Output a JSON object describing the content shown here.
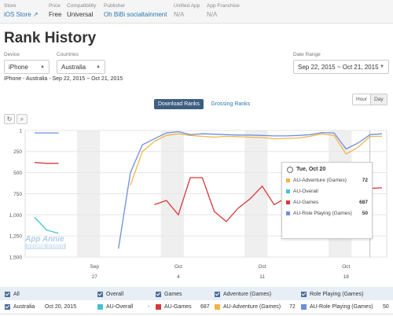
{
  "meta": {
    "store": {
      "label": "Store",
      "value": "iOS Store ↗"
    },
    "price": {
      "label": "Price",
      "value": "Free"
    },
    "compatibility": {
      "label": "Compatibility",
      "value": "Universal"
    },
    "publisher": {
      "label": "Publisher",
      "value": "Oh BiBi socialtainment"
    },
    "unified_app": {
      "label": "Unified App",
      "value": "N/A"
    },
    "app_franchise": {
      "label": "App Franchise",
      "value": "N/A"
    }
  },
  "page_title": "Rank History",
  "filters": {
    "device": {
      "label": "Device",
      "value": "iPhone"
    },
    "countries": {
      "label": "Countries",
      "value": "Australia"
    },
    "date_range": {
      "label": "Date Range",
      "value": "Sep 22, 2015 ~ Oct 21, 2015"
    }
  },
  "subtitle": "IPhone - Australia - Sep 22, 2015 ~ Oct 21, 2015",
  "rank_toggle": {
    "download": "Download Ranks",
    "grossing": "Grossing Ranks"
  },
  "granularity": {
    "hour": "Hour",
    "day": "Day"
  },
  "watermark": {
    "line1": "App Annie",
    "line2": "STORE STATS"
  },
  "chart_data": {
    "type": "line",
    "x_dates": [
      "Sep 22",
      "Sep 23",
      "Sep 24",
      "Sep 25",
      "Sep 26",
      "Sep 27",
      "Sep 28",
      "Sep 29",
      "Sep 30",
      "Oct 1",
      "Oct 2",
      "Oct 3",
      "Oct 4",
      "Oct 5",
      "Oct 6",
      "Oct 7",
      "Oct 8",
      "Oct 9",
      "Oct 10",
      "Oct 11",
      "Oct 12",
      "Oct 13",
      "Oct 14",
      "Oct 15",
      "Oct 16",
      "Oct 17",
      "Oct 18",
      "Oct 19",
      "Oct 20",
      "Oct 21"
    ],
    "x_tick_labels": [
      {
        "month": "Sep",
        "day": "27",
        "index": 5
      },
      {
        "month": "Oct",
        "day": "4",
        "index": 12
      },
      {
        "month": "Oct",
        "day": "11",
        "index": 19
      },
      {
        "month": "Oct",
        "day": "18",
        "index": 26
      }
    ],
    "y_ticks": [
      "1",
      "250",
      "500",
      "750",
      "1,000",
      "1,250",
      "1,500"
    ],
    "ylim": [
      1,
      1500
    ],
    "y_reversed": true,
    "series": [
      {
        "name": "AU-Role Playing (Games)",
        "color": "#6d8fdc",
        "values": [
          30,
          30,
          30,
          null,
          null,
          null,
          null,
          1400,
          500,
          170,
          100,
          30,
          15,
          50,
          40,
          45,
          50,
          55,
          55,
          60,
          65,
          65,
          60,
          50,
          25,
          30,
          220,
          150,
          50,
          40
        ]
      },
      {
        "name": "AU-Adventure (Games)",
        "color": "#f3b545",
        "values": [
          null,
          null,
          null,
          null,
          null,
          null,
          null,
          null,
          650,
          250,
          130,
          60,
          40,
          60,
          70,
          80,
          70,
          75,
          80,
          85,
          100,
          95,
          90,
          70,
          40,
          60,
          280,
          200,
          72,
          70
        ]
      },
      {
        "name": "AU-Games",
        "color": "#d93838",
        "values": [
          380,
          390,
          390,
          null,
          null,
          null,
          null,
          null,
          null,
          null,
          880,
          830,
          1000,
          560,
          560,
          960,
          1080,
          920,
          810,
          660,
          880,
          800,
          920,
          960,
          880,
          1000,
          null,
          null,
          687,
          680
        ]
      },
      {
        "name": "AU-Overall",
        "color": "#47c1cf",
        "values": [
          1030,
          1180,
          1220,
          null,
          null,
          null,
          null,
          null,
          null,
          null,
          null,
          null,
          null,
          null,
          null,
          null,
          null,
          null,
          null,
          null,
          null,
          null,
          null,
          null,
          null,
          null,
          null,
          null,
          null,
          null
        ]
      }
    ]
  },
  "tooltip": {
    "date": "Tue, Oct 20",
    "rows": [
      {
        "name": "AU-Adventure (Games)",
        "value": "72",
        "color": "#f3b545"
      },
      {
        "name": "AU-Overall",
        "value": "",
        "color": "#47c1cf"
      },
      {
        "name": "AU-Games",
        "value": "687",
        "color": "#d93838"
      },
      {
        "name": "AU-Role Playing (Games)",
        "value": "50",
        "color": "#6d8fdc"
      }
    ]
  },
  "legend": {
    "all": "All",
    "overall": "Overall",
    "games": "Games",
    "adventure": "Adventure (Games)",
    "role_playing": "Role Playing (Games)"
  },
  "detail_row": {
    "country": "Australia",
    "date": "Oct 20, 2015",
    "overall_name": "AU-Overall",
    "overall_value": "-",
    "games_name": "AU-Games",
    "games_value": "687",
    "adventure_name": "AU-Adventure (Games)",
    "adventure_value": "72",
    "rpg_name": "AU-Role Playing (Games)",
    "rpg_value": "50"
  },
  "colors": {
    "overall": "#47c1cf",
    "games": "#d93838",
    "adventure": "#f3b545",
    "role_playing": "#6d8fdc",
    "accent": "#3d5e82"
  }
}
